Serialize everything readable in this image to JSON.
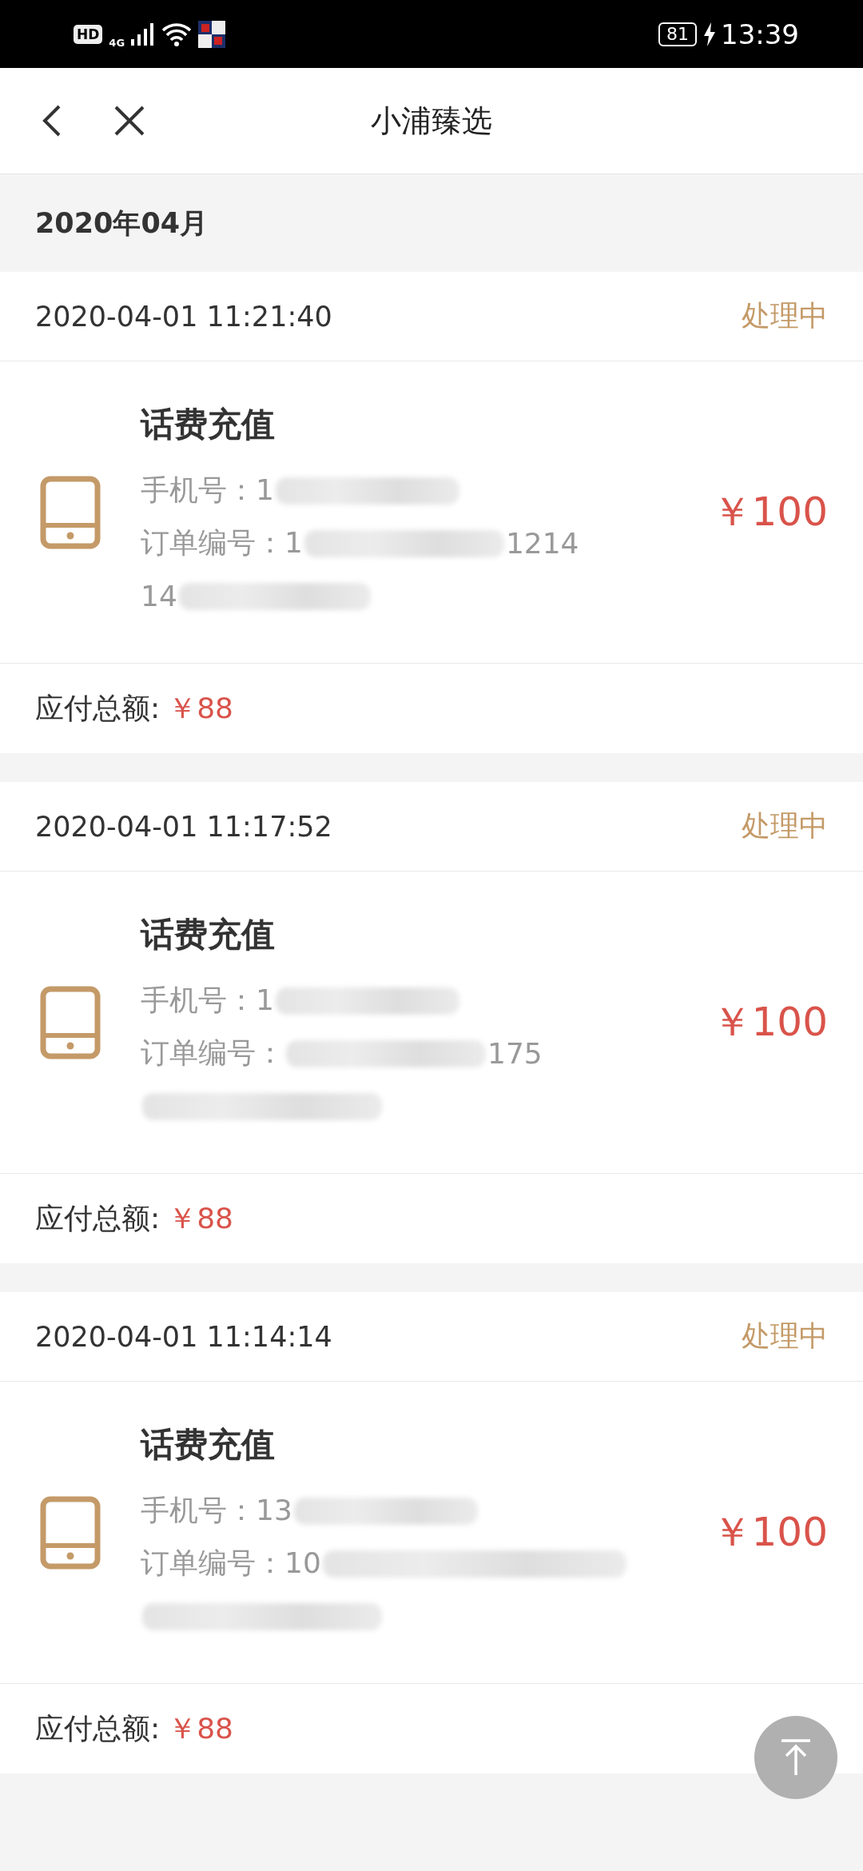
{
  "status_bar": {
    "hd": "HD",
    "network": "4G",
    "battery": "81",
    "charging": true,
    "time": "13:39"
  },
  "header": {
    "title": "小浦臻选"
  },
  "month": "2020年04月",
  "orders": [
    {
      "time": "2020-04-01 11:21:40",
      "status": "处理中",
      "title": "话费充值",
      "phone_label": "手机号：",
      "phone_visible": "1",
      "order_label": "订单编号：",
      "order_start": "1",
      "order_end": "1214",
      "order_line2": "14",
      "price": "￥100",
      "total_label": "应付总额:",
      "total": "￥88"
    },
    {
      "time": "2020-04-01 11:17:52",
      "status": "处理中",
      "title": "话费充值",
      "phone_label": "手机号：",
      "phone_visible": "1",
      "order_label": "订单编号：",
      "order_end": "175",
      "price": "￥100",
      "total_label": "应付总额:",
      "total": "￥88"
    },
    {
      "time": "2020-04-01 11:14:14",
      "status": "处理中",
      "title": "话费充值",
      "phone_label": "手机号：",
      "phone_visible": "13",
      "order_label": "订单编号：",
      "order_start": "10",
      "price": "￥100",
      "total_label": "应付总额:",
      "total": "￥88"
    }
  ]
}
